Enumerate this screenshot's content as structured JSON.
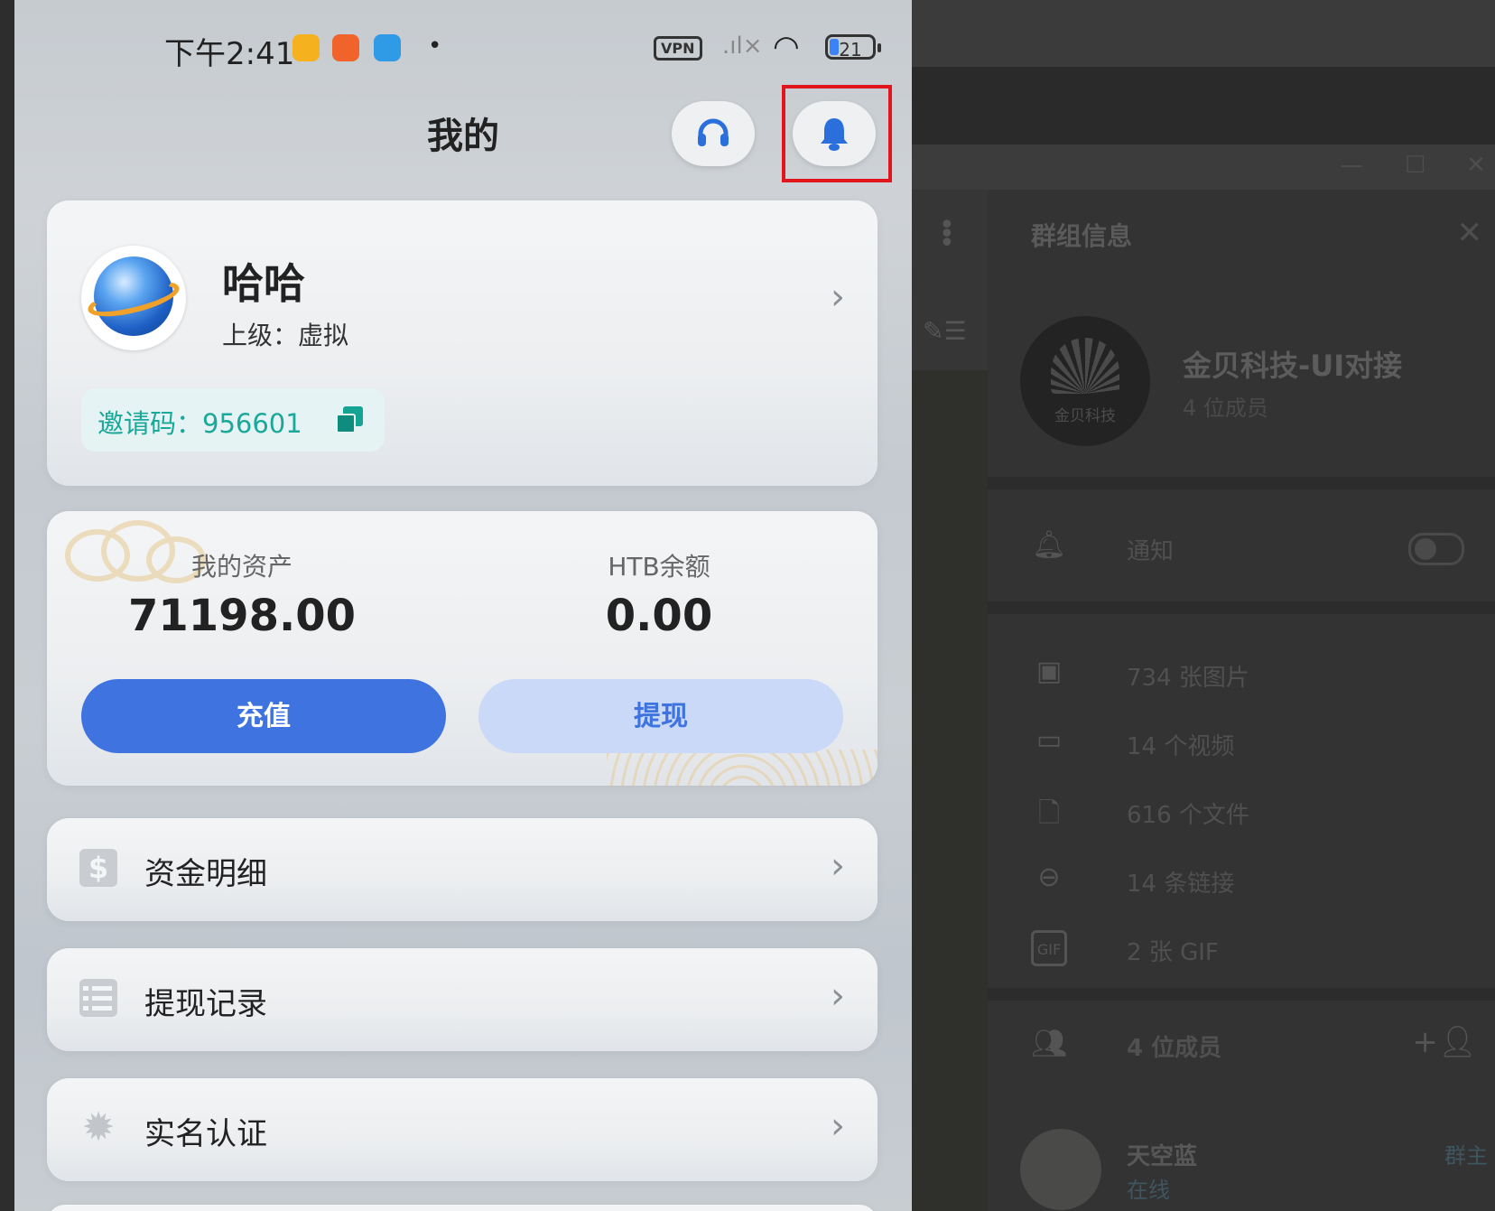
{
  "status_bar": {
    "time": "下午2:41",
    "vpn": "VPN",
    "battery": "21",
    "app_icons": [
      "yellow-app-icon",
      "orange-video-icon",
      "blue-app-icon"
    ]
  },
  "header": {
    "title": "我的",
    "support_icon": "headset-icon",
    "notification_icon": "bell-icon"
  },
  "profile": {
    "name": "哈哈",
    "superior": "上级：虚拟",
    "invite_code_text": "邀请码：956601"
  },
  "assets": {
    "my_assets_label": "我的资产",
    "my_assets_value": "71198.00",
    "htb_label": "HTB余额",
    "htb_value": "0.00",
    "recharge_label": "充值",
    "withdraw_label": "提现"
  },
  "menu": [
    {
      "label": "资金明细",
      "icon": "dollar-icon"
    },
    {
      "label": "提现记录",
      "icon": "list-icon"
    },
    {
      "label": "实名认证",
      "icon": "verified-badge-icon"
    }
  ],
  "group_info": {
    "title": "群组信息",
    "group_name": "金贝科技-UI对接",
    "avatar_text": "金贝科技",
    "member_count": "4 位成员",
    "notify_label": "通知",
    "media": [
      {
        "icon": "image-icon",
        "label": "734 张图片"
      },
      {
        "icon": "video-icon",
        "label": "14 个视频"
      },
      {
        "icon": "file-icon",
        "label": "616 个文件"
      },
      {
        "icon": "link-icon",
        "label": "14 条链接"
      },
      {
        "icon": "gif-icon",
        "label": "2 张 GIF"
      }
    ],
    "members_header": "4 位成员",
    "member": {
      "name": "天空蓝",
      "status": "在线",
      "role": "群主"
    }
  },
  "colors": {
    "primary": "#3f74e0",
    "primary_light": "#c9d9f7",
    "invite_text": "#1aa89a",
    "highlight": "#e0161c"
  }
}
